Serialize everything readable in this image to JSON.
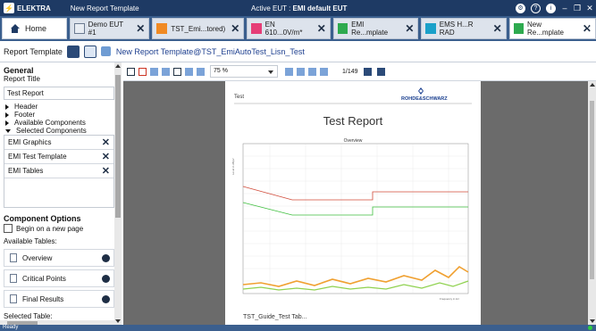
{
  "titlebar": {
    "app_name": "ELEKTRA",
    "document": "New Report Template",
    "active_prefix": "Active EUT : ",
    "active_eut": "EMI default EUT"
  },
  "tabs": {
    "home": "Home",
    "items": [
      {
        "label": "Demo EUT #1",
        "icon": "grey"
      },
      {
        "label": "TST_Emi...tored)",
        "icon": "orange"
      },
      {
        "label": "EN 610...0V/m*",
        "icon": "pink"
      },
      {
        "label": "EMI Re...mplate",
        "icon": "green"
      },
      {
        "label": "EMS H...R RAD",
        "icon": "teal"
      },
      {
        "label": "New Re...mplate",
        "icon": "green"
      }
    ]
  },
  "toolbar": {
    "label": "Report Template",
    "path": "New Report Template@TST_EmiAutoTest_Lisn_Test"
  },
  "left": {
    "general": "General",
    "report_title_label": "Report Title",
    "report_title_value": "Test Report",
    "tree": [
      "Header",
      "Footer",
      "Available Components",
      "Selected Components"
    ],
    "components": [
      "EMI Graphics",
      "EMI Test Template",
      "EMI Tables"
    ],
    "options_title": "Component Options",
    "begin_new_page": "Begin on a new page",
    "available_tables": "Available Tables:",
    "tables": [
      "Overview",
      "Critical Points",
      "Final Results"
    ],
    "selected_table": "Selected Table:"
  },
  "viewer": {
    "zoom": "75 %",
    "page": "1/149"
  },
  "report": {
    "test_label": "Test",
    "brand": "ROHDE&SCHWARZ",
    "title": "Test Report",
    "chart_title": "Overview",
    "y_axis_label": "Level in dBµV",
    "x_axis_label": "Frequency in Hz",
    "heading_partial": "TST_Guide_Test Tab..."
  },
  "status": {
    "text": "Ready"
  }
}
